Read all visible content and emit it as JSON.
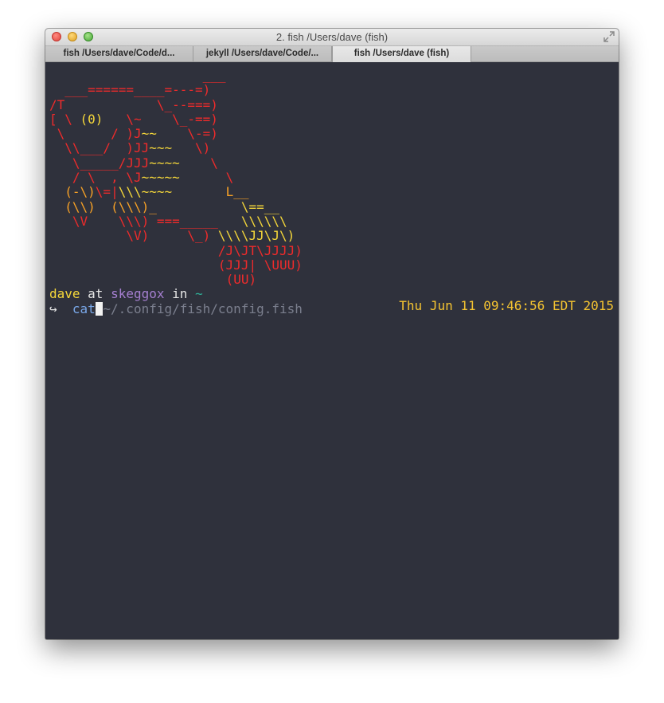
{
  "window": {
    "title": "2. fish  /Users/dave (fish)"
  },
  "tabs": [
    {
      "label": "fish  /Users/dave/Code/d..."
    },
    {
      "label": "jekyll  /Users/dave/Code/..."
    },
    {
      "label": "fish  /Users/dave (fish)",
      "active": true
    }
  ],
  "art": {
    "l0": "                    ___",
    "l1a": "  ___======____",
    "l1b": "=---=)",
    "l2a": "/T",
    "l2b": "            \\_--===)",
    "l3a": "[ \\ ",
    "l3b": "(0)",
    "l3c": "   \\~    \\_-==)",
    "l4a": " \\      / )J",
    "l4b": "~~",
    "l4c": "    \\-=)",
    "l5a": "  \\\\___/  )JJ",
    "l5b": "~~~",
    "l5c": "   \\)",
    "l6a": "   \\_____/JJJ",
    "l6b": "~~~~",
    "l6c": "    \\",
    "l7a": "   / \\  , \\J",
    "l7b": "~~~~~",
    "l7c": "      \\",
    "l8a": "  (-\\)",
    "l8b": "\\=|",
    "l8c": "\\\\\\",
    "l8d": "~~~~",
    "l8e": "       L__",
    "l9a": "  (\\\\)  ",
    "l9b": "(\\\\\\)_",
    "l9c": "           ",
    "l9d": "\\==__",
    "l10a": "   \\V    ",
    "l10b": "\\\\\\) ",
    "l10c": "===_____",
    "l10d": "   \\\\\\\\\\\\",
    "l11a": "          \\V)     ",
    "l11b": "\\_) ",
    "l11c": "\\\\\\\\JJ\\J\\)",
    "l12a": "                      ",
    "l12b": "/J\\JT\\JJJJ)",
    "l13a": "                      ",
    "l13b": "(JJJ| \\UUU)",
    "l14a": "                       ",
    "l14b": "(UU)"
  },
  "prompt": {
    "user": "dave",
    "at": "at",
    "host": "skeggox",
    "in": "in",
    "dir": "~",
    "arrow": "↪",
    "command": "cat",
    "argument": "~/.config/fish/config.fish",
    "datetime": "Thu Jun 11 09:46:56 EDT 2015"
  },
  "colors": {
    "background": "#2f313c",
    "user": "#f5d73a",
    "host": "#a57fd0",
    "dir": "#2fb39a",
    "command": "#79a7e8",
    "datetime": "#f5c431"
  }
}
